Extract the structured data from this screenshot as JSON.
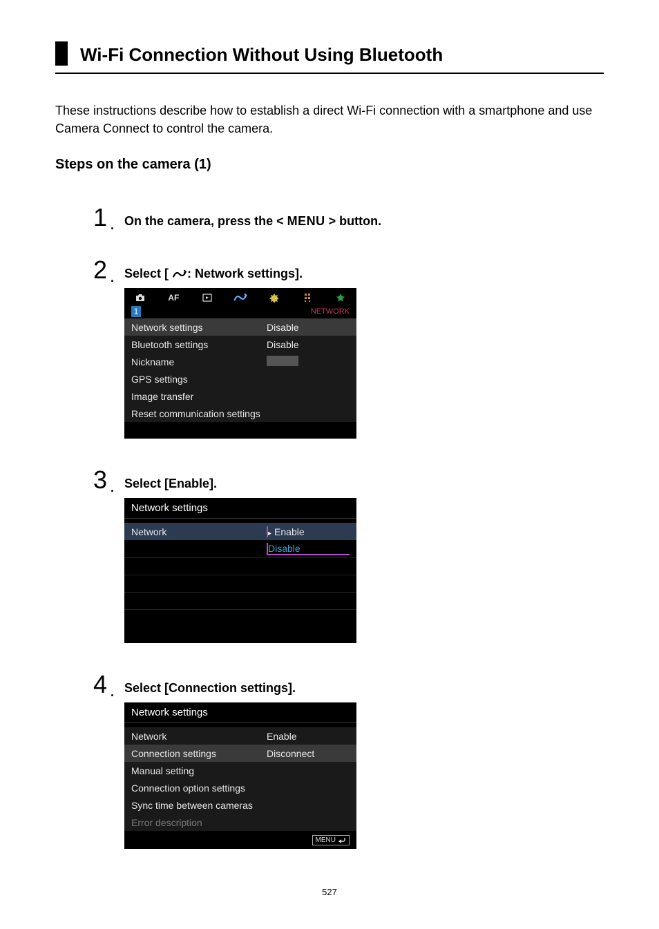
{
  "title": "Wi-Fi Connection Without Using Bluetooth",
  "intro": "These instructions describe how to establish a direct Wi-Fi connection with a smartphone and use Camera Connect to control the camera.",
  "steps_head": "Steps on the camera (1)",
  "pageNum": "527",
  "step1": {
    "prefix": "On the camera, press the < ",
    "btn": "MENU",
    "suffix": " > button."
  },
  "step2": {
    "prefix": "Select [ ",
    "suffix": ": Network settings].",
    "screen": {
      "subtabLabel": "NETWORK",
      "pageNum": "1",
      "rows": [
        {
          "label": "Network settings",
          "value": "Disable",
          "sel": true
        },
        {
          "label": "Bluetooth settings",
          "value": "Disable"
        },
        {
          "label": "Nickname",
          "value": ""
        },
        {
          "label": "GPS settings",
          "value": ""
        },
        {
          "label": "Image transfer",
          "value": ""
        },
        {
          "label": "Reset communication settings",
          "value": ""
        }
      ]
    }
  },
  "step3": {
    "title": "Select [Enable].",
    "screen": {
      "header": "Network settings",
      "left": "Network",
      "enable": "Enable",
      "disable": "Disable"
    }
  },
  "step4": {
    "title": "Select [Connection settings].",
    "screen": {
      "header": "Network settings",
      "rows": [
        {
          "label": "Network",
          "value": "Enable"
        },
        {
          "label": "Connection settings",
          "value": "Disconnect",
          "sel": true
        },
        {
          "label": "Manual setting",
          "value": ""
        },
        {
          "label": "Connection option settings",
          "value": ""
        },
        {
          "label": "Sync time between cameras",
          "value": ""
        },
        {
          "label": "Error description",
          "value": "",
          "dim": true
        }
      ],
      "footer": "MENU"
    }
  }
}
